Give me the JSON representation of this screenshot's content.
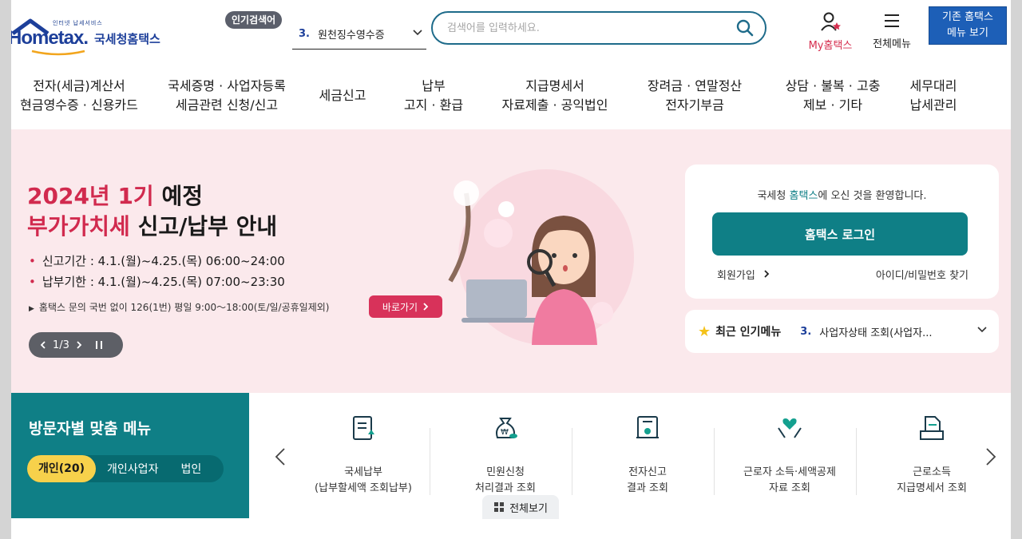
{
  "header": {
    "logo_subtitle": "인터넷 납세서비스",
    "logo_brand": "Hometax.",
    "logo_korean": "국세청홈택스",
    "popular_badge": "인기검색어",
    "popular_rank": "3.",
    "popular_term": "원천징수영수증",
    "search_placeholder": "검색어를 입력하세요.",
    "my_hometax": "My홈택스",
    "all_menu": "전체메뉴",
    "old_hometax_line1": "기존 홈택스",
    "old_hometax_line2": "메뉴 보기"
  },
  "nav": [
    {
      "line1": "전자(세금)계산서",
      "line2": "현금영수증 · 신용카드"
    },
    {
      "line1": "국세증명 · 사업자등록",
      "line2": "세금관련 신청/신고"
    },
    {
      "line1": "세금신고",
      "line2": ""
    },
    {
      "line1": "납부",
      "line2": "고지 · 환급"
    },
    {
      "line1": "지급명세서",
      "line2": "자료제출 · 공익법인"
    },
    {
      "line1": "장려금 · 연말정산",
      "line2": "전자기부금"
    },
    {
      "line1": "상담 · 불복 · 고충",
      "line2": "제보 · 기타"
    },
    {
      "line1": "세무대리",
      "line2": "납세관리"
    }
  ],
  "hero": {
    "title1_red": "2024년 1기",
    "title1_dark": "예정",
    "title2_red": "부가가치세",
    "title2_dark": "신고/납부 안내",
    "bullet1": "신고기간 : 4.1.(월)~4.25.(목) 06:00~24:00",
    "bullet2": "납부기한 : 4.1.(월)~4.25.(목) 07:00~23:30",
    "note": "홈택스 문의 국번 없이 126(1번) 평일 9:00～18:00(토/일/공휴일제외)",
    "go_button": "바로가기",
    "pager": "1/3"
  },
  "login": {
    "welcome_prefix": "국세청 ",
    "welcome_brand": "홈택스",
    "welcome_suffix": "에 오신 것을 환영합니다.",
    "login_button": "홈택스 로그인",
    "join": "회원가입",
    "find": "아이디/비밀번호 찾기"
  },
  "recent": {
    "title": "최근 인기메뉴",
    "rank": "3.",
    "item": "사업자상태 조회(사업자..."
  },
  "visitor": {
    "title": "방문자별 맞춤 메뉴",
    "tabs": [
      "개인(20)",
      "개인사업자",
      "법인"
    ]
  },
  "cards": [
    {
      "icon": "tax-payment-icon",
      "line1": "국세납부",
      "line2": "(납부할세액 조회납부)"
    },
    {
      "icon": "money-bag-icon",
      "line1": "민원신청",
      "line2": "처리결과 조회"
    },
    {
      "icon": "certificate-icon",
      "line1": "전자신고",
      "line2": "결과 조회"
    },
    {
      "icon": "heart-hands-icon",
      "line1": "근로자 소득·세액공제",
      "line2": "자료 조회"
    },
    {
      "icon": "document-tray-icon",
      "line1": "근로소득",
      "line2": "지급명세서 조회"
    }
  ],
  "view_all": "전체보기",
  "colors": {
    "brand_blue": "#1d3f9a",
    "accent_red": "#d12a4e",
    "teal": "#0f7f86",
    "hero_bg": "#fbe9ec"
  }
}
